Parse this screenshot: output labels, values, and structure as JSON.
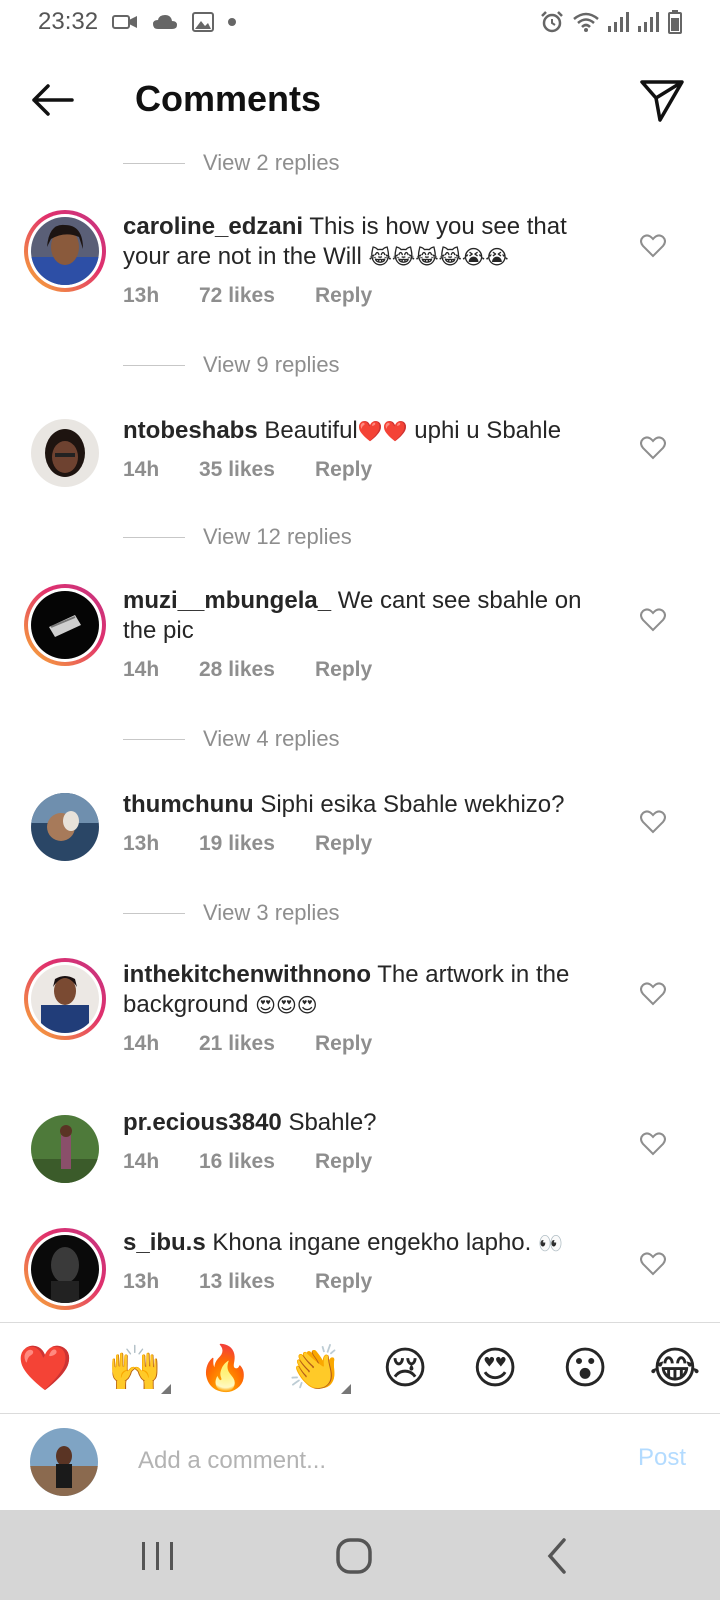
{
  "status_bar": {
    "time": "23:32"
  },
  "header": {
    "title": "Comments"
  },
  "replies_links": [
    "View 2 replies",
    "View 9 replies",
    "View 12 replies",
    "View 4 replies",
    "View 3 replies"
  ],
  "comments": [
    {
      "user": "caroline_edzani",
      "text": "This is how you see that your are not in the Will",
      "emoji": "😹😹😹😹😭😭",
      "time": "13h",
      "likes": "72 likes",
      "reply": "Reply"
    },
    {
      "user": "ntobeshabs",
      "text": "Beautiful",
      "emoji": "❤️❤️",
      "text2": " uphi u Sbahle",
      "time": "14h",
      "likes": "35 likes",
      "reply": "Reply"
    },
    {
      "user": "muzi__mbungela_",
      "text": "We cant see sbahle on the pic",
      "time": "14h",
      "likes": "28 likes",
      "reply": "Reply"
    },
    {
      "user": "thumchunu",
      "text": "Siphi esika Sbahle wekhizo?",
      "time": "13h",
      "likes": "19 likes",
      "reply": "Reply"
    },
    {
      "user": "inthekitchenwithnono",
      "text": "The artwork in the background",
      "emoji": "😍😍😍",
      "time": "14h",
      "likes": "21 likes",
      "reply": "Reply"
    },
    {
      "user": "pr.ecious3840",
      "text": "Sbahle?",
      "time": "14h",
      "likes": "16 likes",
      "reply": "Reply"
    },
    {
      "user": "s_ibu.s",
      "text": "Khona ingane engekho lapho.",
      "emoji": "👀",
      "time": "13h",
      "likes": "13 likes",
      "reply": "Reply"
    }
  ],
  "emoji_bar": [
    "❤️",
    "🙌",
    "🔥",
    "👏",
    "😢",
    "😍",
    "😮",
    "😂"
  ],
  "add_comment": {
    "placeholder": "Add a comment...",
    "post_label": "Post"
  }
}
